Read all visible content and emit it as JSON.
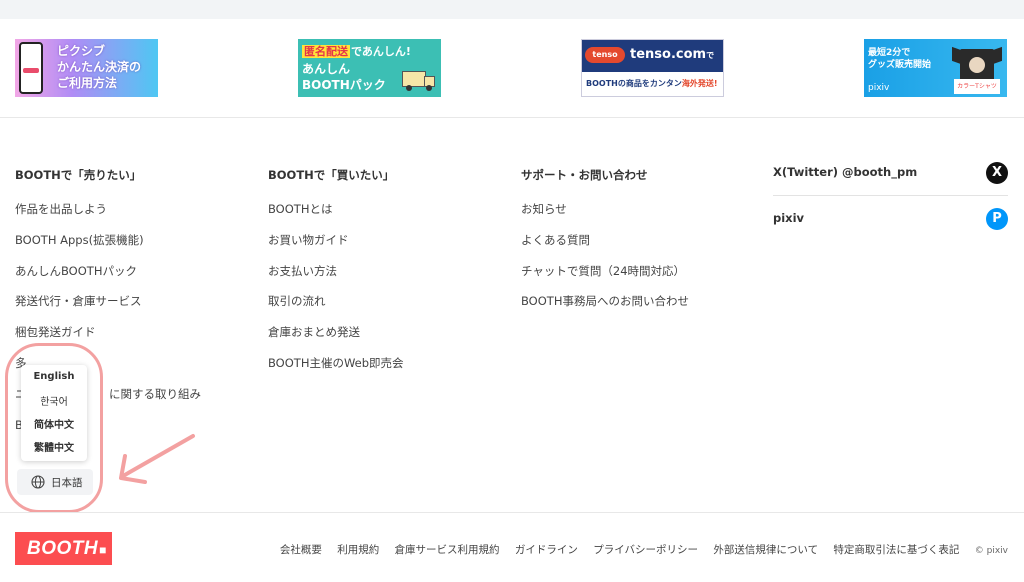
{
  "banners": {
    "pay": {
      "line1": "ピクシブ",
      "line2": "かんたん決済の",
      "line3": "ご利用方法"
    },
    "pack": {
      "tags": "匿名配送",
      "tag_suffix": "であんしん!",
      "line1": "あんしん",
      "line2": "BOOTHパック"
    },
    "tenso": {
      "logo": "tenso",
      "brand": "tenso.com",
      "brand_suffix": "で",
      "bottom": "BOOTHの商品をカンタン",
      "bottom_red": "海外発送!"
    },
    "goods": {
      "line1": "最短2分で",
      "line2": "グッズ販売開始",
      "pixiv": "pixiv",
      "tag": "カラーTシャツ"
    }
  },
  "columns": [
    {
      "title": "BOOTHで「売りたい」",
      "links": [
        "作品を出品しよう",
        "BOOTH Apps(拡張機能)",
        "あんしんBOOTHパック",
        "発送代行・倉庫サービス",
        "梱包発送ガイド",
        "多",
        "ニ 作",
        "に関する取り組み",
        "B"
      ]
    },
    {
      "title": "BOOTHで「買いたい」",
      "links": [
        "BOOTHとは",
        "お買い物ガイド",
        "お支払い方法",
        "取引の流れ",
        "倉庫おまとめ発送",
        "BOOTH主催のWeb即売会"
      ]
    },
    {
      "title": "サポート・お問い合わせ",
      "links": [
        "お知らせ",
        "よくある質問",
        "チャットで質問（24時間対応）",
        "BOOTH事務局へのお問い合わせ"
      ]
    }
  ],
  "social": {
    "twitter": {
      "label": "X(Twitter) @booth_pm",
      "icon": "x-logo-icon",
      "glyph": "X"
    },
    "pixiv": {
      "label": "pixiv",
      "icon": "pixiv-logo-icon",
      "glyph": "P"
    }
  },
  "language": {
    "options": [
      "English",
      "한국어",
      "简体中文",
      "繁體中文"
    ],
    "current": "日本語"
  },
  "footer": {
    "logo": "BOOTH",
    "links": [
      "会社概要",
      "利用規約",
      "倉庫サービス利用規約",
      "ガイドライン",
      "プライバシーポリシー",
      "外部送信規律について",
      "特定商取引法に基づく表記"
    ],
    "copyright": "© pixiv"
  },
  "colors": {
    "brand": "#fc4d50",
    "highlight": "#f3a1a1",
    "pixiv": "#0096fa"
  }
}
